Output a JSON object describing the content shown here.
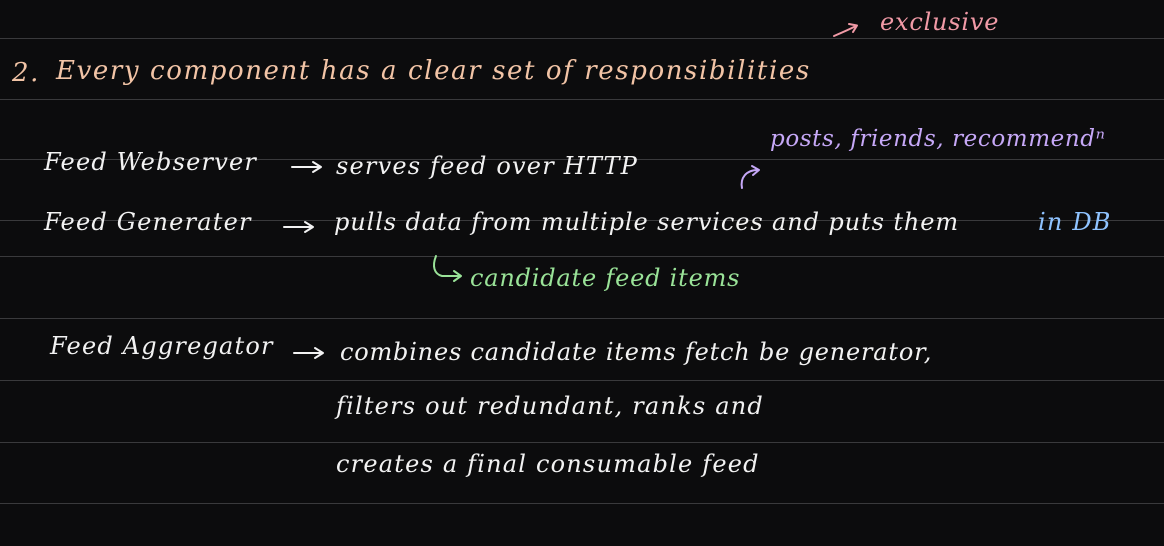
{
  "heading": {
    "number": "2.",
    "text": "Every component has a clear set of responsibilities",
    "annotation": "exclusive"
  },
  "webserver": {
    "component": "Feed Webserver",
    "description": "serves feed over HTTP"
  },
  "sources_note": "posts, friends, recommendⁿ",
  "generator": {
    "component": "Feed Generater",
    "description": "pulls data from multiple services and puts them",
    "description_highlight": "in DB",
    "subnote": "candidate feed items"
  },
  "aggregator": {
    "component": "Feed Aggregator",
    "lines": [
      "combines candidate items fetch be generator,",
      "filters out redundant, ranks and",
      "creates a final consumable feed"
    ]
  },
  "colors": {
    "background": "#0c0c0d",
    "ruled_line": "#3a3a3c",
    "heading": "#f2c4a6",
    "annotation": "#f19aa6",
    "sources_note": "#c6a8f7",
    "body_text": "#f2f2f2",
    "highlight": "#8fc3ff",
    "subnote": "#9ae398"
  }
}
